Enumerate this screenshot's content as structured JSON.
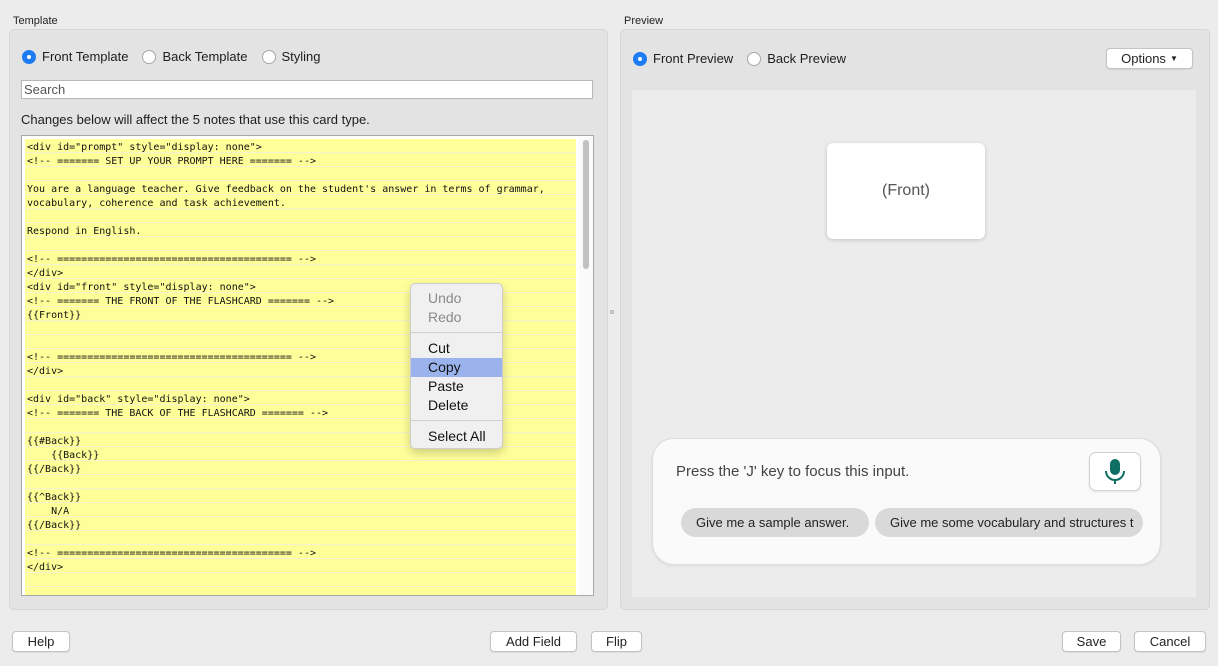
{
  "template": {
    "group_title": "Template",
    "radios": [
      {
        "label": "Front Template",
        "selected": true
      },
      {
        "label": "Back Template",
        "selected": false
      },
      {
        "label": "Styling",
        "selected": false
      }
    ],
    "search_placeholder": "Search",
    "info": "Changes below will affect the 5 notes that use this card type.",
    "code": "<div id=\"prompt\" style=\"display: none\">\n<!-- ======= SET UP YOUR PROMPT HERE ======= -->\n\nYou are a language teacher. Give feedback on the student's answer in terms of grammar,\nvocabulary, coherence and task achievement.\n\nRespond in English.\n\n<!-- ======================================= -->\n</div>\n<div id=\"front\" style=\"display: none\">\n<!-- ======= THE FRONT OF THE FLASHCARD ======= -->\n{{Front}}\n\n\n<!-- ======================================= -->\n</div>\n\n<div id=\"back\" style=\"display: none\">\n<!-- ======= THE BACK OF THE FLASHCARD ======= -->\n\n{{#Back}}\n    {{Back}}\n{{/Back}}\n\n{{^Back}}\n    N/A\n{{/Back}}\n\n<!-- ======================================= -->\n</div>"
  },
  "context_menu": {
    "items": [
      {
        "label": "Undo",
        "enabled": false
      },
      {
        "label": "Redo",
        "enabled": false
      },
      {
        "label": "Cut",
        "enabled": true
      },
      {
        "label": "Copy",
        "enabled": true,
        "highlighted": true
      },
      {
        "label": "Paste",
        "enabled": true
      },
      {
        "label": "Delete",
        "enabled": true
      },
      {
        "label": "Select All",
        "enabled": true
      }
    ]
  },
  "preview": {
    "group_title": "Preview",
    "radios": [
      {
        "label": "Front Preview",
        "selected": true
      },
      {
        "label": "Back Preview",
        "selected": false
      }
    ],
    "options_label": "Options",
    "card_text": "(Front)",
    "chat_placeholder": "Press the 'J' key to focus this input.",
    "suggestions": [
      "Give me a sample answer.",
      "Give me some vocabulary and structures t"
    ]
  },
  "footer": {
    "help": "Help",
    "add_field": "Add Field",
    "flip": "Flip",
    "save": "Save",
    "cancel": "Cancel"
  },
  "colors": {
    "accent": "#1e7cf2",
    "code_highlight": "#ffff9a",
    "menu_highlight": "#9bb3ec",
    "mic_icon": "#0f6e64"
  }
}
